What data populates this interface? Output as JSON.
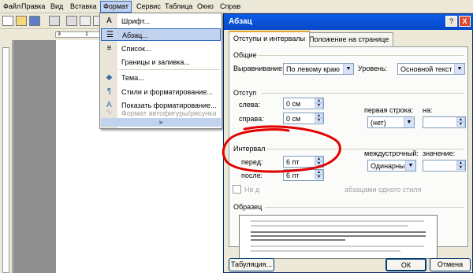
{
  "menubar": {
    "items": [
      "Файл",
      "Правка",
      "Вид",
      "Вставка",
      "Формат",
      "Сервис",
      "Таблица",
      "Окно",
      "Справ"
    ],
    "active": "Формат"
  },
  "ruler": {
    "marks": [
      "3",
      "1"
    ]
  },
  "format_menu": {
    "items": [
      {
        "icon": "font-icon",
        "label": "Шрифт..."
      },
      {
        "icon": "paragraph-icon",
        "label": "Абзац..."
      },
      {
        "icon": "list-icon",
        "label": "Список..."
      },
      {
        "icon": "borders-icon",
        "label": "Границы и заливка..."
      },
      {
        "icon": "theme-icon",
        "label": "Тема..."
      },
      {
        "icon": "styles-icon",
        "label": "Стили и форматирование..."
      },
      {
        "icon": "reveal-formatting-icon",
        "label": "Показать форматирование..."
      },
      {
        "icon": "autoshape-format-icon",
        "label": "Формат автофигуры/рисунка"
      }
    ],
    "highlighted": "Абзац...",
    "more": "»"
  },
  "dialog": {
    "title": "Абзац",
    "help_label": "?",
    "close_label": "X",
    "tabs": [
      "Отступы и интервалы",
      "Положение на странице"
    ],
    "general": {
      "title": "Общие",
      "alignment_label": "Выравнивание:",
      "alignment_value": "По левому краю",
      "level_label": "Уровень:",
      "level_value": "Основной текст"
    },
    "indent": {
      "title": "Отступ",
      "left_label": "слева:",
      "left_value": "0 см",
      "right_label": "справа:",
      "right_value": "0 см",
      "first_line_label": "первая строка:",
      "first_line_value": "(нет)",
      "on_label": "на:",
      "on_value": ""
    },
    "spacing": {
      "title": "Интервал",
      "before_label": "перед:",
      "before_value": "6 пт",
      "after_label": "после:",
      "after_value": "6 пт",
      "line_label": "междустрочный:",
      "line_value": "Одинарный",
      "value_label": "значение:",
      "value_value": "",
      "no_space_label_start": "Не д",
      "no_space_label_end": "абзацами одного стиля"
    },
    "preview_title": "Образец",
    "buttons": {
      "tabs": "Табуляция...",
      "ok": "ОК",
      "cancel": "Отмена"
    }
  },
  "colors": {
    "annotation": "#e10000",
    "titlebar": "#0a5be4",
    "highlight": "#c1d2ee"
  }
}
